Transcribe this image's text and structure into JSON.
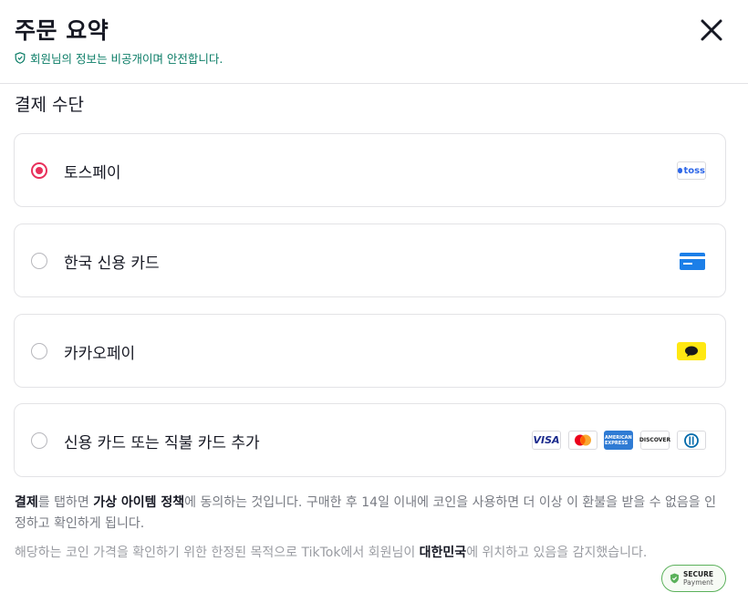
{
  "header": {
    "title": "주문 요약",
    "privacy_note": "회원님의 정보는 비공개이며 안전합니다."
  },
  "payment": {
    "section_title": "결제 수단",
    "options": [
      {
        "label": "토스페이",
        "selected": true,
        "icon": "toss-logo",
        "icon_text": "toss"
      },
      {
        "label": "한국 신용 카드",
        "selected": false,
        "icon": "credit-card-icon"
      },
      {
        "label": "카카오페이",
        "selected": false,
        "icon": "kakao-chat-icon"
      },
      {
        "label": "신용 카드 또는 직불 카드 추가",
        "selected": false,
        "brands": [
          "VISA",
          "mastercard",
          "AMERICAN EXPRESS",
          "DISCOVER",
          "diners"
        ]
      }
    ]
  },
  "brands": {
    "visa": "VISA",
    "amex": "AMERICAN EXPRESS",
    "discover": "DISCOVER"
  },
  "terms": {
    "part1_bold": "결제",
    "part2": "를 탭하면 ",
    "part3_bold": "가상 아이템 정책",
    "part4": "에 동의하는 것입니다. 구매한 후 14일 이내에 코인을 사용하면 더 이상 이 환불을 받을 수 없음을 인정하고 확인하게 됩니다."
  },
  "notice": {
    "part1": "해당하는 코인 가격을 확인하기 위한 한정된 목적으로 TikTok에서 회원님이 ",
    "part2_bold": "대한민국",
    "part3": "에 위치하고 있음을 감지했습니다."
  },
  "secure_badge": {
    "line1": "SECURE",
    "line2": "Payment"
  },
  "colors": {
    "accent": "#e8305b",
    "privacy_green": "#0a7c66",
    "secure_green": "#5bb15b",
    "toss_blue": "#2d66e8",
    "kakao_yellow": "#ffe812",
    "card_blue": "#1c7fe8"
  }
}
